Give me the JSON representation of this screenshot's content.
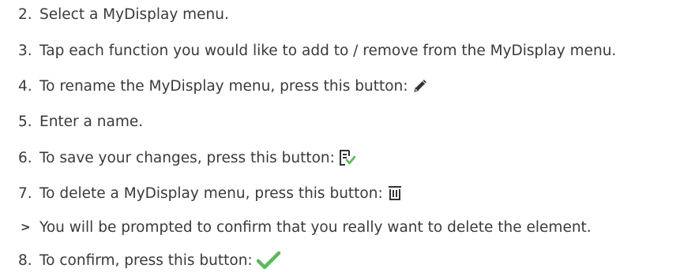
{
  "steps": [
    {
      "number": "2.",
      "text": "Select a MyDisplay menu."
    },
    {
      "number": "3.",
      "text": "Tap each function you would like to add to / remove from the MyDisplay menu."
    },
    {
      "number": "4.",
      "text": "To rename the MyDisplay menu, press this button:",
      "icon": "pencil-icon"
    },
    {
      "number": "5.",
      "text": "Enter a name."
    },
    {
      "number": "6.",
      "text": "To save your changes, press this button:",
      "icon": "save-check-icon"
    },
    {
      "number": "7.",
      "text": "To delete a MyDisplay menu, press this button:",
      "icon": "trash-icon"
    },
    {
      "number": ">",
      "text": "You will be prompted to confirm that you really want to delete the element.",
      "type": "result"
    },
    {
      "number": "8.",
      "text": "To confirm, press this button:",
      "icon": "checkmark-icon"
    }
  ],
  "colors": {
    "text": "#3a3a3a",
    "accent_green": "#5cb85c",
    "icon_dark": "#333333"
  }
}
